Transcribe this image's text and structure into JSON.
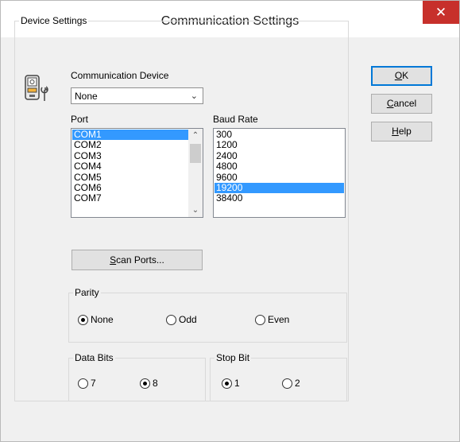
{
  "window": {
    "title": "Communication Settings",
    "close_glyph": "✕"
  },
  "device_settings": {
    "label": "Device Settings",
    "comm_device_label": "Communication Device",
    "comm_device_value": "None",
    "icon": "device-wrench-icon"
  },
  "port": {
    "label": "Port",
    "items": [
      "COM1",
      "COM2",
      "COM3",
      "COM4",
      "COM5",
      "COM6",
      "COM7"
    ],
    "selected": "COM1"
  },
  "baud": {
    "label": "Baud Rate",
    "items": [
      "300",
      "1200",
      "2400",
      "4800",
      "9600",
      "19200",
      "38400"
    ],
    "selected": "19200"
  },
  "buttons": {
    "scan_mnemonic": "S",
    "scan_rest": "can Ports...",
    "ok_mnemonic": "O",
    "ok_rest": "K",
    "cancel_mnemonic": "C",
    "cancel_rest": "ancel",
    "help_mnemonic": "H",
    "help_rest": "elp"
  },
  "parity": {
    "label": "Parity",
    "options": [
      {
        "label": "None",
        "checked": true
      },
      {
        "label": "Odd",
        "checked": false
      },
      {
        "label": "Even",
        "checked": false
      }
    ]
  },
  "data_bits": {
    "label": "Data Bits",
    "options": [
      {
        "label": "7",
        "checked": false
      },
      {
        "label": "8",
        "checked": true
      }
    ]
  },
  "stop_bit": {
    "label": "Stop Bit",
    "options": [
      {
        "label": "1",
        "checked": true
      },
      {
        "label": "2",
        "checked": false
      }
    ]
  },
  "colors": {
    "selection": "#3399ff",
    "close_button": "#c7302b",
    "default_button_border": "#0078d7"
  }
}
